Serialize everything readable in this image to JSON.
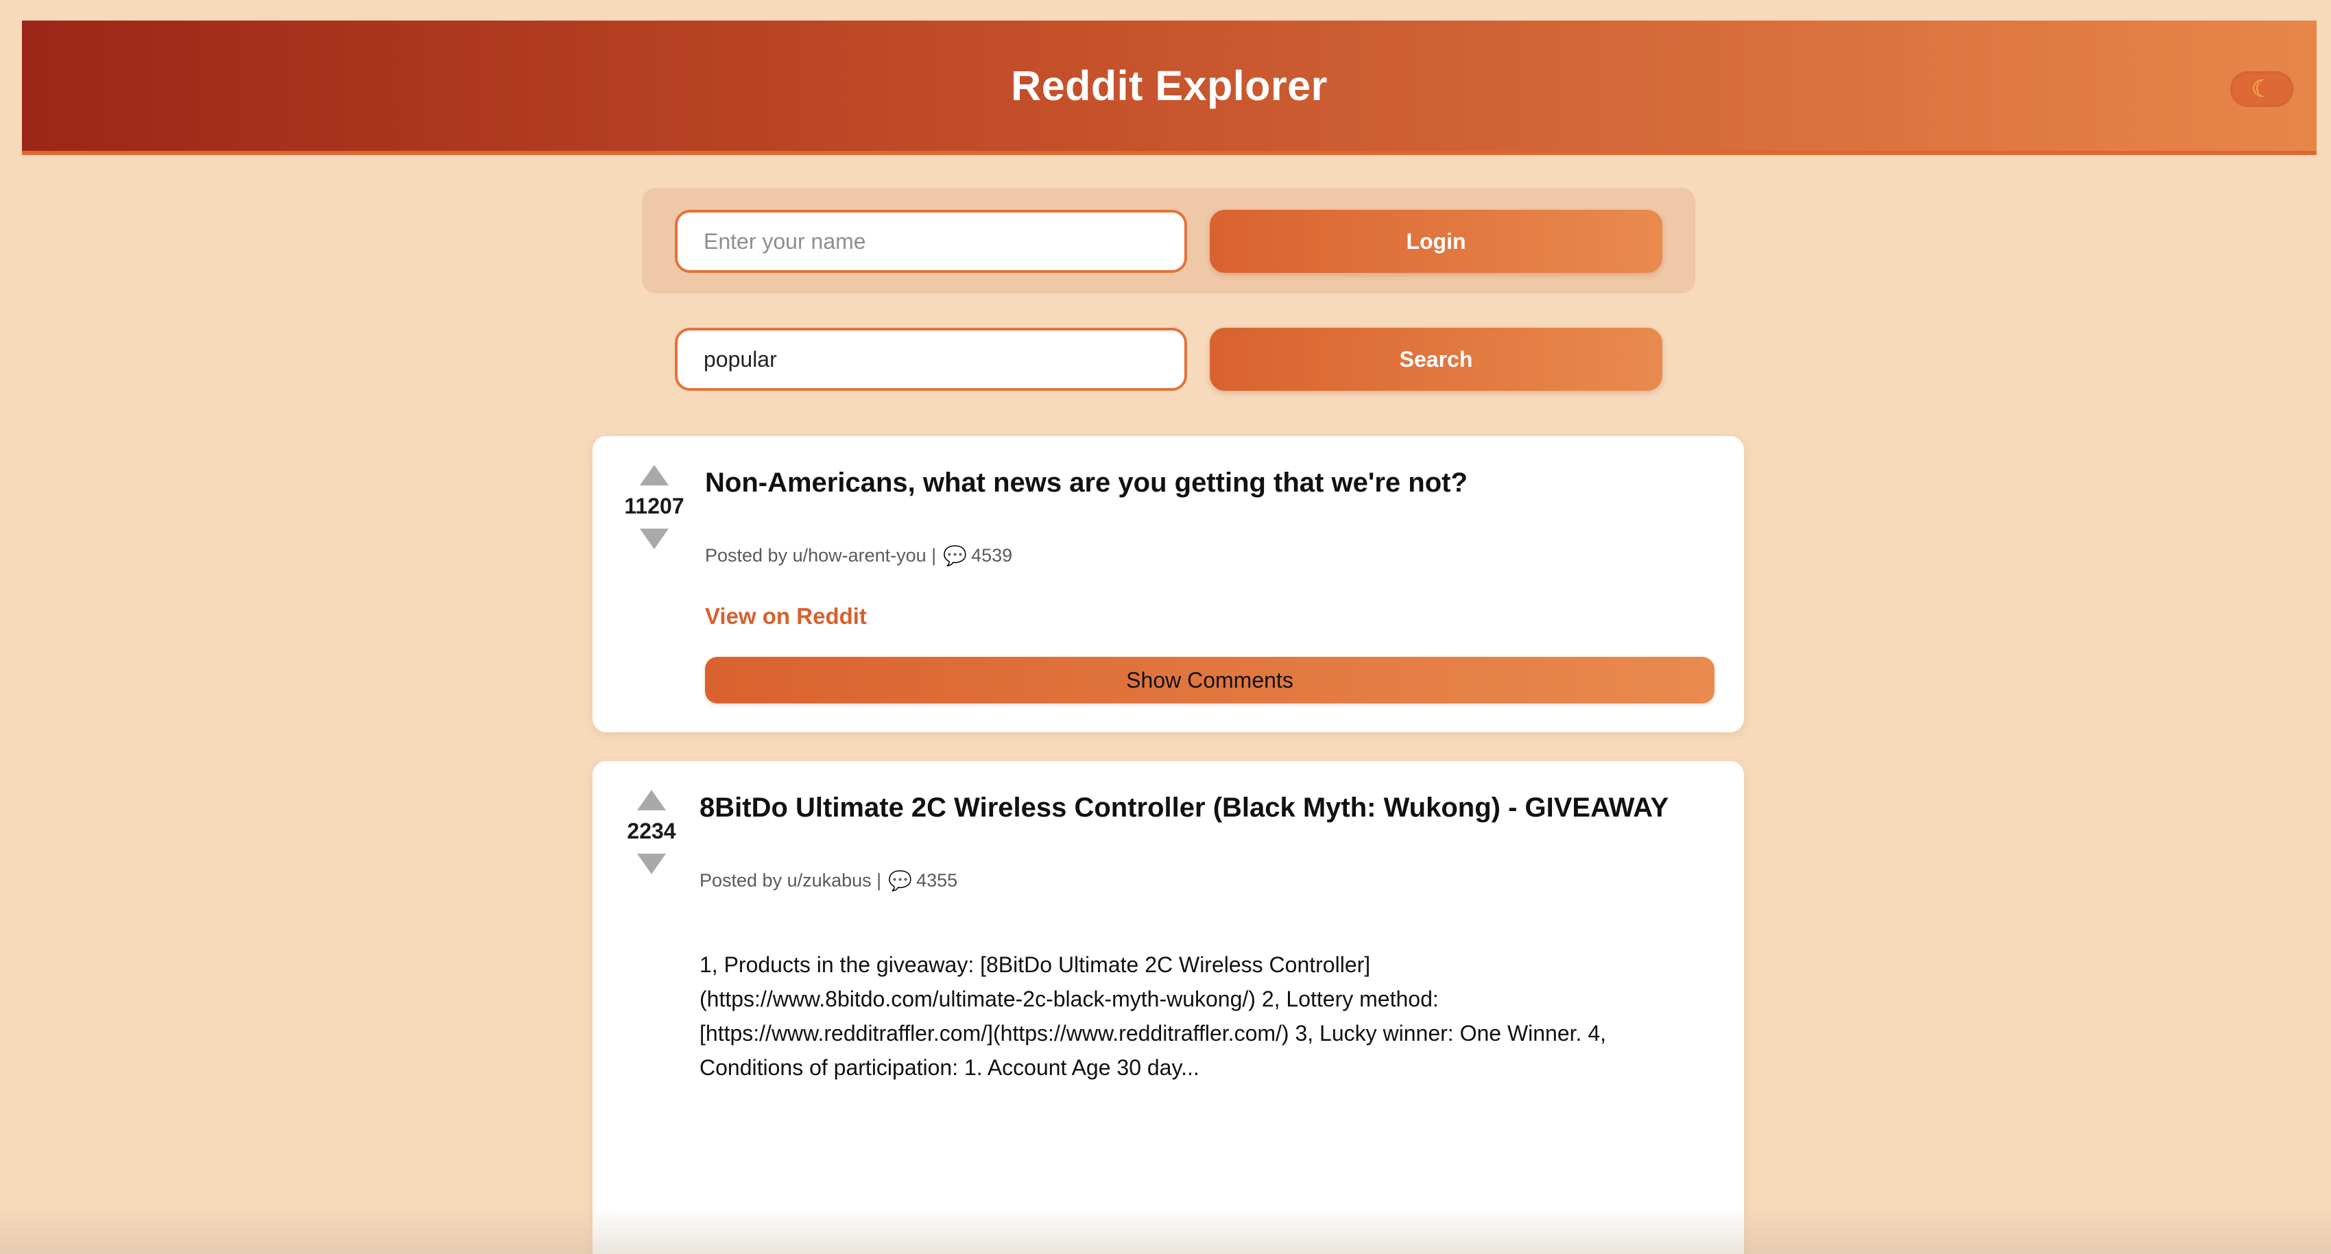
{
  "header": {
    "title": "Reddit Explorer",
    "theme_toggle_icon": "moon-icon"
  },
  "login": {
    "name_placeholder": "Enter your name",
    "name_value": "",
    "login_label": "Login"
  },
  "search": {
    "value": "popular",
    "search_label": "Search"
  },
  "posts": [
    {
      "score": "11207",
      "title": "Non-Americans, what news are you getting that we're not?",
      "posted_by": "Posted by u/how-arent-you |",
      "comments": "4539",
      "view_link": "View on Reddit",
      "show_comments_label": "Show Comments"
    },
    {
      "score": "2234",
      "title": "8BitDo Ultimate 2C Wireless Controller (Black Myth: Wukong) - GIVEAWAY",
      "posted_by": "Posted by u/zukabus |",
      "comments": "4355",
      "body_lines": [
        "1, Products in the giveaway: [8BitDo Ultimate 2C Wireless Controller]",
        "(https://www.8bitdo.com/ultimate-2c-black-myth-wukong/) 2, Lottery method:",
        "[https://www.redditraffler.com/](https://www.redditraffler.com/) 3, Lucky winner: One Winner. 4,",
        "Conditions of participation: 1. Account Age 30 day..."
      ]
    }
  ],
  "colors": {
    "accent": "#e3733a",
    "background": "#f7d9bb",
    "link": "#d8602c"
  }
}
